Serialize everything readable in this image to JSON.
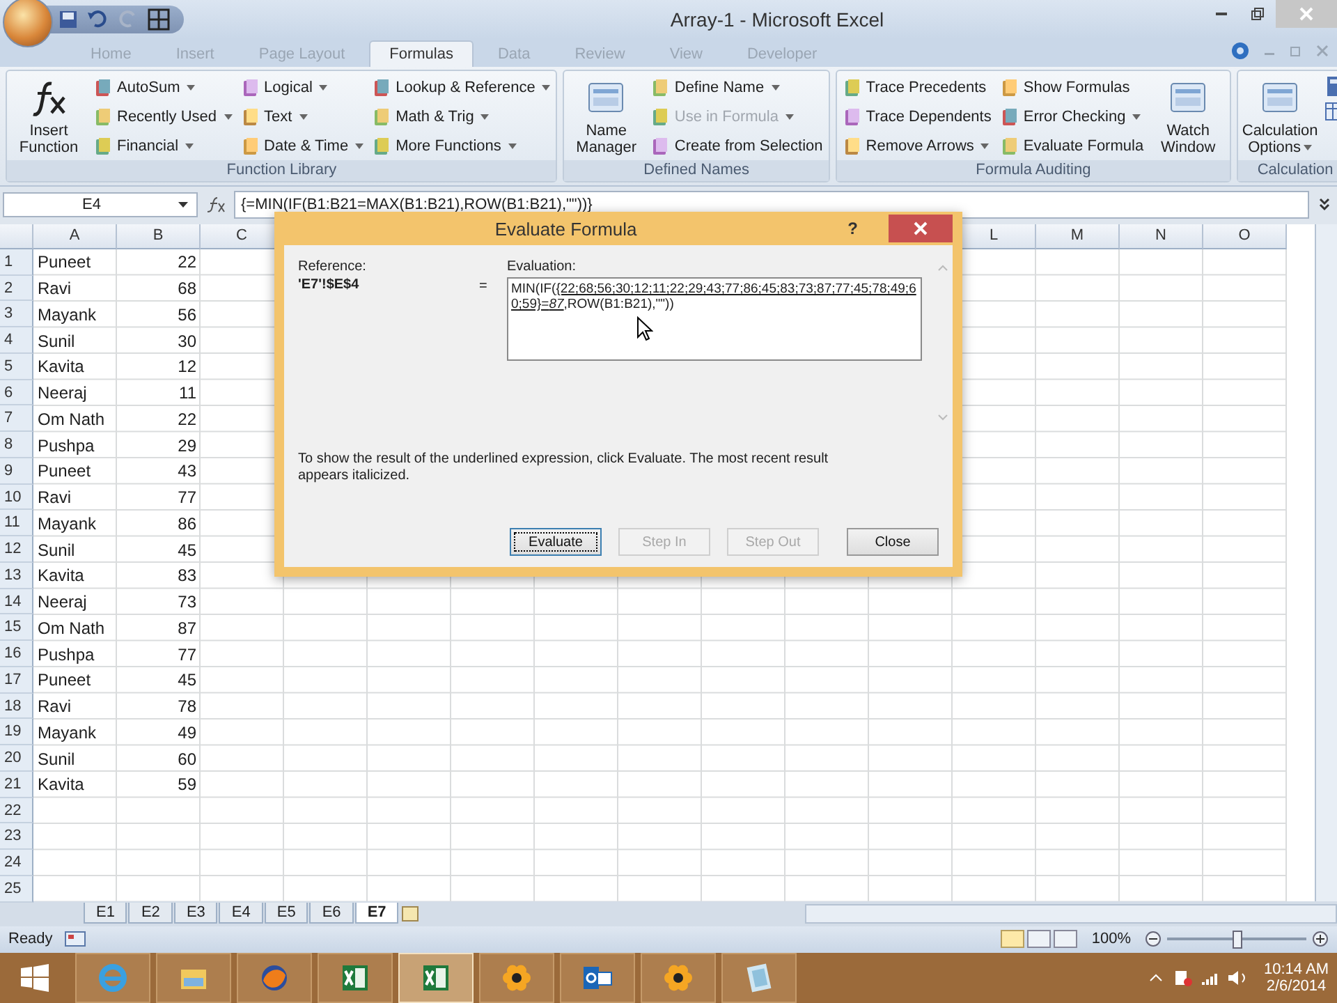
{
  "window": {
    "title": "Array-1 - Microsoft Excel"
  },
  "ribbon_tabs": [
    {
      "label": "Home",
      "selected": false
    },
    {
      "label": "Insert",
      "selected": false
    },
    {
      "label": "Page Layout",
      "selected": false
    },
    {
      "label": "Formulas",
      "selected": true
    },
    {
      "label": "Data",
      "selected": false
    },
    {
      "label": "Review",
      "selected": false
    },
    {
      "label": "View",
      "selected": false
    },
    {
      "label": "Developer",
      "selected": false
    }
  ],
  "ribbon_groups": [
    {
      "title": "Function Library",
      "large": [
        {
          "label": "Insert Function",
          "menu": false
        }
      ],
      "columns": [
        [
          {
            "label": "AutoSum",
            "menu": true,
            "disabled": false
          },
          {
            "label": "Recently Used",
            "menu": true,
            "disabled": false
          },
          {
            "label": "Financial",
            "menu": true,
            "disabled": false
          }
        ],
        [
          {
            "label": "Logical",
            "menu": true,
            "disabled": false
          },
          {
            "label": "Text",
            "menu": true,
            "disabled": false
          },
          {
            "label": "Date & Time",
            "menu": true,
            "disabled": false
          }
        ],
        [
          {
            "label": "Lookup & Reference",
            "menu": true,
            "disabled": false
          },
          {
            "label": "Math & Trig",
            "menu": true,
            "disabled": false
          },
          {
            "label": "More Functions",
            "menu": true,
            "disabled": false
          }
        ]
      ]
    },
    {
      "title": "Defined Names",
      "large": [
        {
          "label": "Name Manager",
          "menu": false
        }
      ],
      "columns": [
        [
          {
            "label": "Define Name",
            "menu": true,
            "disabled": false
          },
          {
            "label": "Use in Formula",
            "menu": true,
            "disabled": true
          },
          {
            "label": "Create from Selection",
            "menu": false,
            "disabled": false
          }
        ]
      ]
    },
    {
      "title": "Formula Auditing",
      "columns": [
        [
          {
            "label": "Trace Precedents",
            "menu": false,
            "disabled": false
          },
          {
            "label": "Trace Dependents",
            "menu": false,
            "disabled": false
          },
          {
            "label": "Remove Arrows",
            "menu": true,
            "disabled": false
          }
        ],
        [
          {
            "label": "Show Formulas",
            "menu": false,
            "disabled": false
          },
          {
            "label": "Error Checking",
            "menu": true,
            "disabled": false
          },
          {
            "label": "Evaluate Formula",
            "menu": false,
            "disabled": false
          }
        ]
      ],
      "large_after": [
        {
          "label": "Watch Window",
          "menu": false
        }
      ]
    },
    {
      "title": "Calculation",
      "large": [
        {
          "label": "Calculation Options",
          "menu": true
        }
      ]
    }
  ],
  "formula_bar": {
    "name_box": "E4",
    "formula": "{=MIN(IF(B1:B21=MAX(B1:B21),ROW(B1:B21),\"\"))}"
  },
  "columns_left": [
    "A",
    "B",
    "C"
  ],
  "columns_right": [
    "L",
    "M",
    "N",
    "O"
  ],
  "rows": [
    {
      "number": "1",
      "name": "Puneet",
      "value": "22"
    },
    {
      "number": "2",
      "name": "Ravi",
      "value": "68"
    },
    {
      "number": "3",
      "name": "Mayank",
      "value": "56"
    },
    {
      "number": "4",
      "name": "Sunil",
      "value": "30"
    },
    {
      "number": "5",
      "name": "Kavita",
      "value": "12"
    },
    {
      "number": "6",
      "name": "Neeraj",
      "value": "11"
    },
    {
      "number": "7",
      "name": "Om Nath",
      "value": "22"
    },
    {
      "number": "8",
      "name": "Pushpa",
      "value": "29"
    },
    {
      "number": "9",
      "name": "Puneet",
      "value": "43"
    },
    {
      "number": "10",
      "name": "Ravi",
      "value": "77"
    },
    {
      "number": "11",
      "name": "Mayank",
      "value": "86"
    },
    {
      "number": "12",
      "name": "Sunil",
      "value": "45"
    },
    {
      "number": "13",
      "name": "Kavita",
      "value": "83"
    },
    {
      "number": "14",
      "name": "Neeraj",
      "value": "73"
    },
    {
      "number": "15",
      "name": "Om Nath",
      "value": "87"
    },
    {
      "number": "16",
      "name": "Pushpa",
      "value": "77"
    },
    {
      "number": "17",
      "name": "Puneet",
      "value": "45"
    },
    {
      "number": "18",
      "name": "Ravi",
      "value": "78"
    },
    {
      "number": "19",
      "name": "Mayank",
      "value": "49"
    },
    {
      "number": "20",
      "name": "Sunil",
      "value": "60"
    },
    {
      "number": "21",
      "name": "Kavita",
      "value": "59"
    },
    {
      "number": "22"
    },
    {
      "number": "23"
    },
    {
      "number": "24"
    },
    {
      "number": "25"
    }
  ],
  "dialog": {
    "title": "Evaluate Formula",
    "help": "?",
    "reference_label": "Reference:",
    "reference": "'E7'!$E$4",
    "equals": "=",
    "evaluation_label": "Evaluation:",
    "evaluation": {
      "before": "MIN(IF(",
      "underlined": "{22;68;56;30;12;11;22;29;43;77;86;45;83;73;87;77;45;78;49;60;59}=*87*",
      "after": ",ROW(B1:B21),\"\"))"
    },
    "hint": "To show the result of the underlined expression, click Evaluate.  The most recent result appears italicized.",
    "buttons": [
      {
        "label": "Evaluate",
        "disabled": false,
        "focused": true
      },
      {
        "label": "Step In",
        "disabled": true,
        "focused": false
      },
      {
        "label": "Step Out",
        "disabled": true,
        "focused": false
      },
      {
        "label": "Close",
        "disabled": false,
        "focused": false
      }
    ]
  },
  "sheet_tabs": [
    {
      "label": "E1",
      "selected": false
    },
    {
      "label": "E2",
      "selected": false
    },
    {
      "label": "E3",
      "selected": false
    },
    {
      "label": "E4",
      "selected": false
    },
    {
      "label": "E5",
      "selected": false
    },
    {
      "label": "E6",
      "selected": false
    },
    {
      "label": "E7",
      "selected": true
    }
  ],
  "status_bar": {
    "status": "Ready",
    "zoom": "100%",
    "zoom_level": {
      "level": 0.5
    }
  },
  "taskbar": {
    "apps": [
      {
        "selected": false
      },
      {
        "selected": false
      },
      {
        "selected": false
      },
      {
        "selected": false
      },
      {
        "selected": true
      },
      {
        "selected": false
      },
      {
        "selected": false
      },
      {
        "selected": false
      },
      {
        "selected": false
      }
    ],
    "time": "10:14 AM",
    "date": "2/6/2014"
  }
}
